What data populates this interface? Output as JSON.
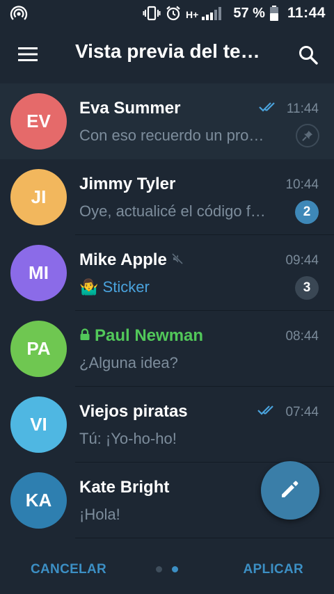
{
  "status_bar": {
    "network": "H+",
    "battery_percent": "57 %",
    "time": "11:44",
    "icons": [
      "hotspot-icon",
      "vibrate-icon",
      "alarm-icon",
      "signal-icon",
      "battery-icon"
    ]
  },
  "toolbar": {
    "title": "Vista previa del te…",
    "menu_icon": "menu-icon",
    "search_icon": "search-icon"
  },
  "chats": [
    {
      "initials": "EV",
      "name": "Eva Summer",
      "time": "11:44",
      "message": "Con eso recuerdo un pro…",
      "avatar_color": "#e56a6a",
      "read": true,
      "pinned": true
    },
    {
      "initials": "JI",
      "name": "Jimmy Tyler",
      "time": "10:44",
      "message": "Oye, actualicé el código f…",
      "avatar_color": "#f2b75d",
      "unread": "2"
    },
    {
      "initials": "MI",
      "name": "Mike Apple",
      "time": "09:44",
      "message_emoji": "🤷‍♂️",
      "message": "Sticker",
      "avatar_color": "#8b6be8",
      "muted": true,
      "unread": "3"
    },
    {
      "initials": "PA",
      "name": "Paul Newman",
      "time": "08:44",
      "message": "¿Alguna idea?",
      "avatar_color": "#6fc751",
      "secret": true
    },
    {
      "initials": "VI",
      "name": "Viejos piratas",
      "time": "07:44",
      "message": "Tú: ¡Yo-ho-ho!",
      "avatar_color": "#4fb7e2",
      "read": true
    },
    {
      "initials": "KA",
      "name": "Kate Bright",
      "time": "",
      "message": "¡Hola!",
      "avatar_color": "#2e7fb0"
    }
  ],
  "fab": {
    "icon": "pencil-icon"
  },
  "bottom_bar": {
    "cancel_label": "CANCELAR",
    "apply_label": "APLICAR",
    "page_count": 2,
    "active_page": 2
  },
  "colors": {
    "background": "#1d2733",
    "accent": "#3c8fc4",
    "secret_green": "#52c85a"
  }
}
